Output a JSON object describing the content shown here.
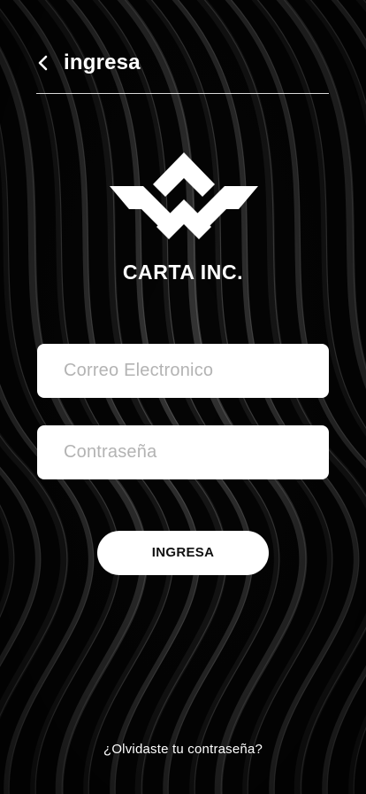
{
  "header": {
    "back_icon": "chevron-left-icon",
    "title": "ingresa"
  },
  "brand": {
    "logo_icon": "w-chevron-logo",
    "name": "CARTA INC."
  },
  "form": {
    "email_placeholder": "Correo Electronico",
    "email_value": "",
    "password_placeholder": "Contraseña",
    "password_value": "",
    "submit_label": "INGRESA"
  },
  "forgot_password_label": "¿Olvidaste tu contraseña?",
  "colors": {
    "background": "#000000",
    "foreground": "#ffffff",
    "placeholder": "#b3b3b3"
  }
}
